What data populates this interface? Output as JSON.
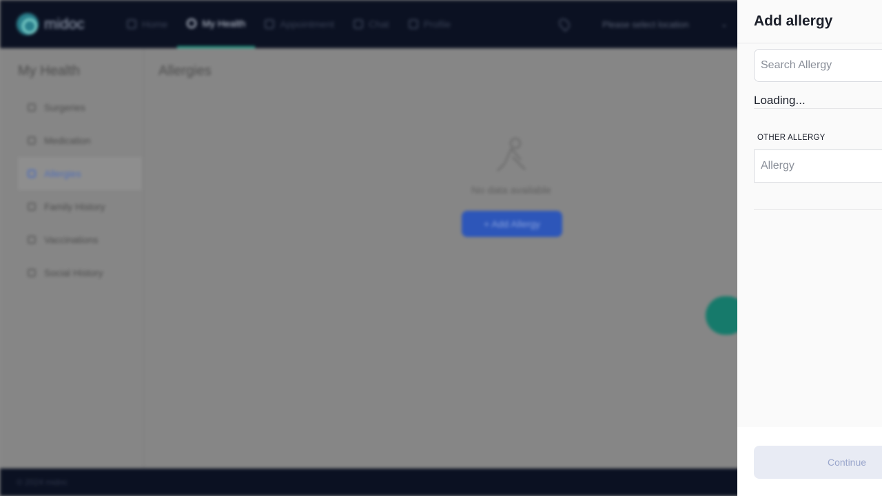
{
  "app": {
    "logo_text": "midoc",
    "nav": [
      {
        "label": "Home",
        "icon": "home-icon"
      },
      {
        "label": "My Health",
        "icon": "heart-icon",
        "active": true
      },
      {
        "label": "Appointment",
        "icon": "calendar-icon"
      },
      {
        "label": "Chat",
        "icon": "chat-icon"
      },
      {
        "label": "Profile",
        "icon": "user-icon"
      }
    ],
    "location_placeholder": "Please select location",
    "sidebar": {
      "title": "My Health",
      "items": [
        {
          "label": "Surgeries",
          "icon": "surgery-icon"
        },
        {
          "label": "Medication",
          "icon": "medication-icon"
        },
        {
          "label": "Allergies",
          "icon": "allergy-icon",
          "active": true
        },
        {
          "label": "Family History",
          "icon": "family-icon"
        },
        {
          "label": "Vaccinations",
          "icon": "syringe-icon"
        },
        {
          "label": "Social History",
          "icon": "glass-icon"
        }
      ]
    },
    "main": {
      "title": "Allergies",
      "empty_text": "No data available",
      "add_button": "+ Add Allergy"
    },
    "footer_text": "© 2024 midoc"
  },
  "drawer": {
    "title": "Add allergy",
    "search_placeholder": "Search Allergy",
    "loading_text": "Loading...",
    "other_label": "OTHER ALLERGY",
    "other_placeholder": "Allergy",
    "continue_label": "Continue"
  },
  "colors": {
    "accent": "#1f9e88",
    "primary": "#2d56b9",
    "drawer_bg": "#fafafa",
    "disabled_button_bg": "#e8ebf4",
    "disabled_button_text": "#9aa6cc"
  }
}
